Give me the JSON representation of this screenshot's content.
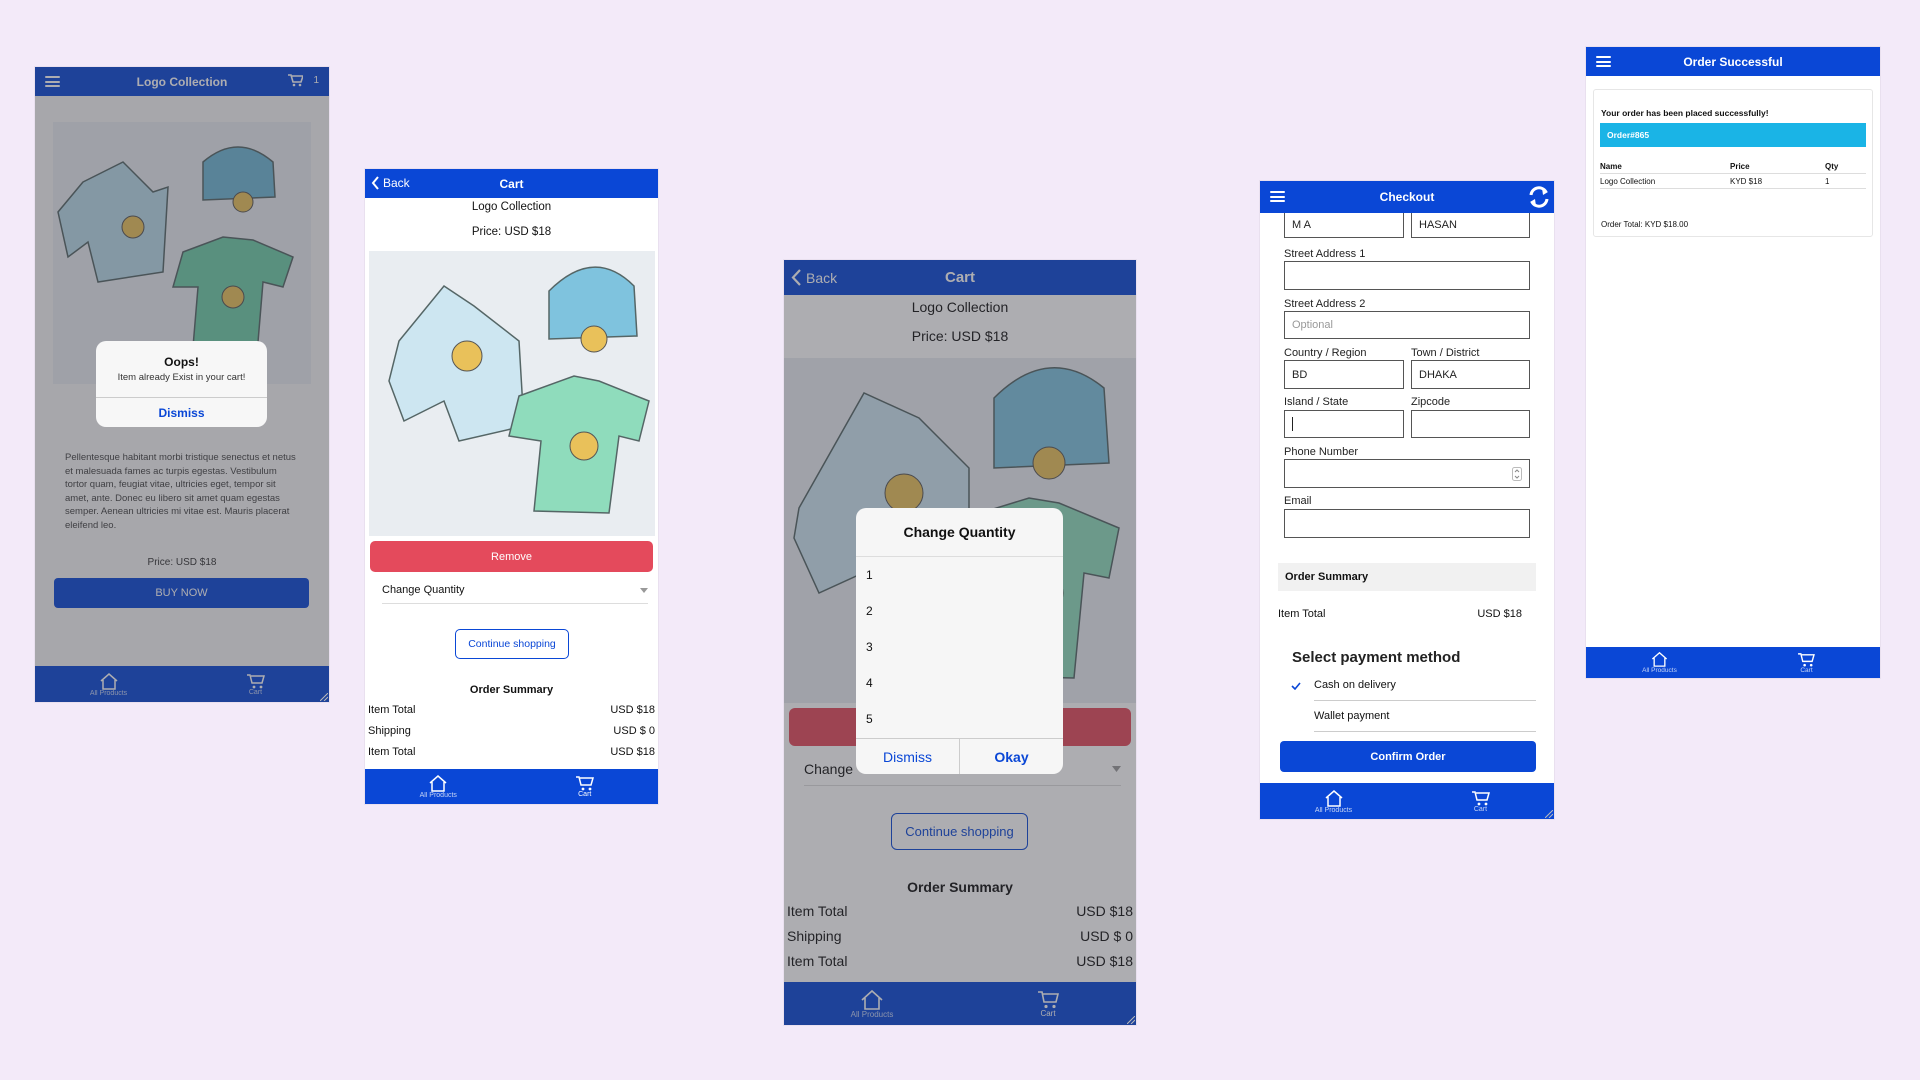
{
  "colors": {
    "background": "#f3eaf9",
    "primary": "#0a47d6",
    "danger": "#e44a5c",
    "accent": "#1ab4e6"
  },
  "tabbar": {
    "home_label": "All Products",
    "cart_label": "Cart",
    "home_icon": "home-icon",
    "cart_icon": "cart-icon"
  },
  "screen1": {
    "title": "Logo Collection",
    "cart_count": "1",
    "product_title": "Logo Collection",
    "description": "Pellentesque habitant morbi tristique senectus et netus et malesuada fames ac turpis egestas. Vestibulum tortor quam, feugiat vitae, ultricies eget, tempor sit amet, ante. Donec eu libero sit amet quam egestas semper. Aenean ultricies mi vitae est. Mauris placerat eleifend leo.",
    "price": "Price: USD $18",
    "buy_now": "BUY NOW",
    "alert": {
      "title": "Oops!",
      "message": "Item already Exist in your cart!",
      "dismiss": "Dismiss"
    }
  },
  "screen2": {
    "back": "Back",
    "title": "Cart",
    "product_name": "Logo Collection",
    "price": "Price: USD $18",
    "remove": "Remove",
    "change_quantity": "Change Quantity",
    "continue": "Continue shopping",
    "summary_title": "Order Summary",
    "summary": [
      {
        "label": "Item Total",
        "value": "USD $18"
      },
      {
        "label": "Shipping",
        "value": "USD $ 0"
      },
      {
        "label": "Item Total",
        "value": "USD $18"
      }
    ]
  },
  "screen3": {
    "back": "Back",
    "title": "Cart",
    "product_name": "Logo Collection",
    "price": "Price: USD $18",
    "change_partial": "Change",
    "continue": "Continue shopping",
    "summary_title": "Order Summary",
    "summary": [
      {
        "label": "Item Total",
        "value": "USD $18"
      },
      {
        "label": "Shipping",
        "value": "USD $ 0"
      },
      {
        "label": "Item Total",
        "value": "USD $18"
      }
    ],
    "picker": {
      "title": "Change Quantity",
      "options": [
        "1",
        "2",
        "3",
        "4",
        "5"
      ],
      "dismiss": "Dismiss",
      "okay": "Okay"
    }
  },
  "screen4": {
    "title": "Checkout",
    "first_name": "M A",
    "last_name": "HASAN",
    "street1_label": "Street Address 1",
    "street1_value": "",
    "street2_label": "Street Address 2",
    "street2_placeholder": "Optional",
    "country_label": "Country / Region",
    "country_value": "BD",
    "town_label": "Town / District",
    "town_value": "DHAKA",
    "island_label": "Island / State",
    "zip_label": "Zipcode",
    "phone_label": "Phone Number",
    "email_label": "Email",
    "summary_title": "Order Summary",
    "item_total_label": "Item Total",
    "item_total_value": "USD $18",
    "payment_title": "Select payment method",
    "payment_options": [
      "Cash on delivery",
      "Wallet payment"
    ],
    "selected_payment": "Cash on delivery",
    "confirm": "Confirm Order"
  },
  "screen5": {
    "title": "Order Successful",
    "message": "Your order has been placed successfully!",
    "order_id": "Order#865",
    "headers": [
      "Name",
      "Price",
      "Qty"
    ],
    "rows": [
      [
        "Logo Collection",
        "KYD $18",
        "1"
      ]
    ],
    "total": "Order Total: KYD $18.00"
  }
}
